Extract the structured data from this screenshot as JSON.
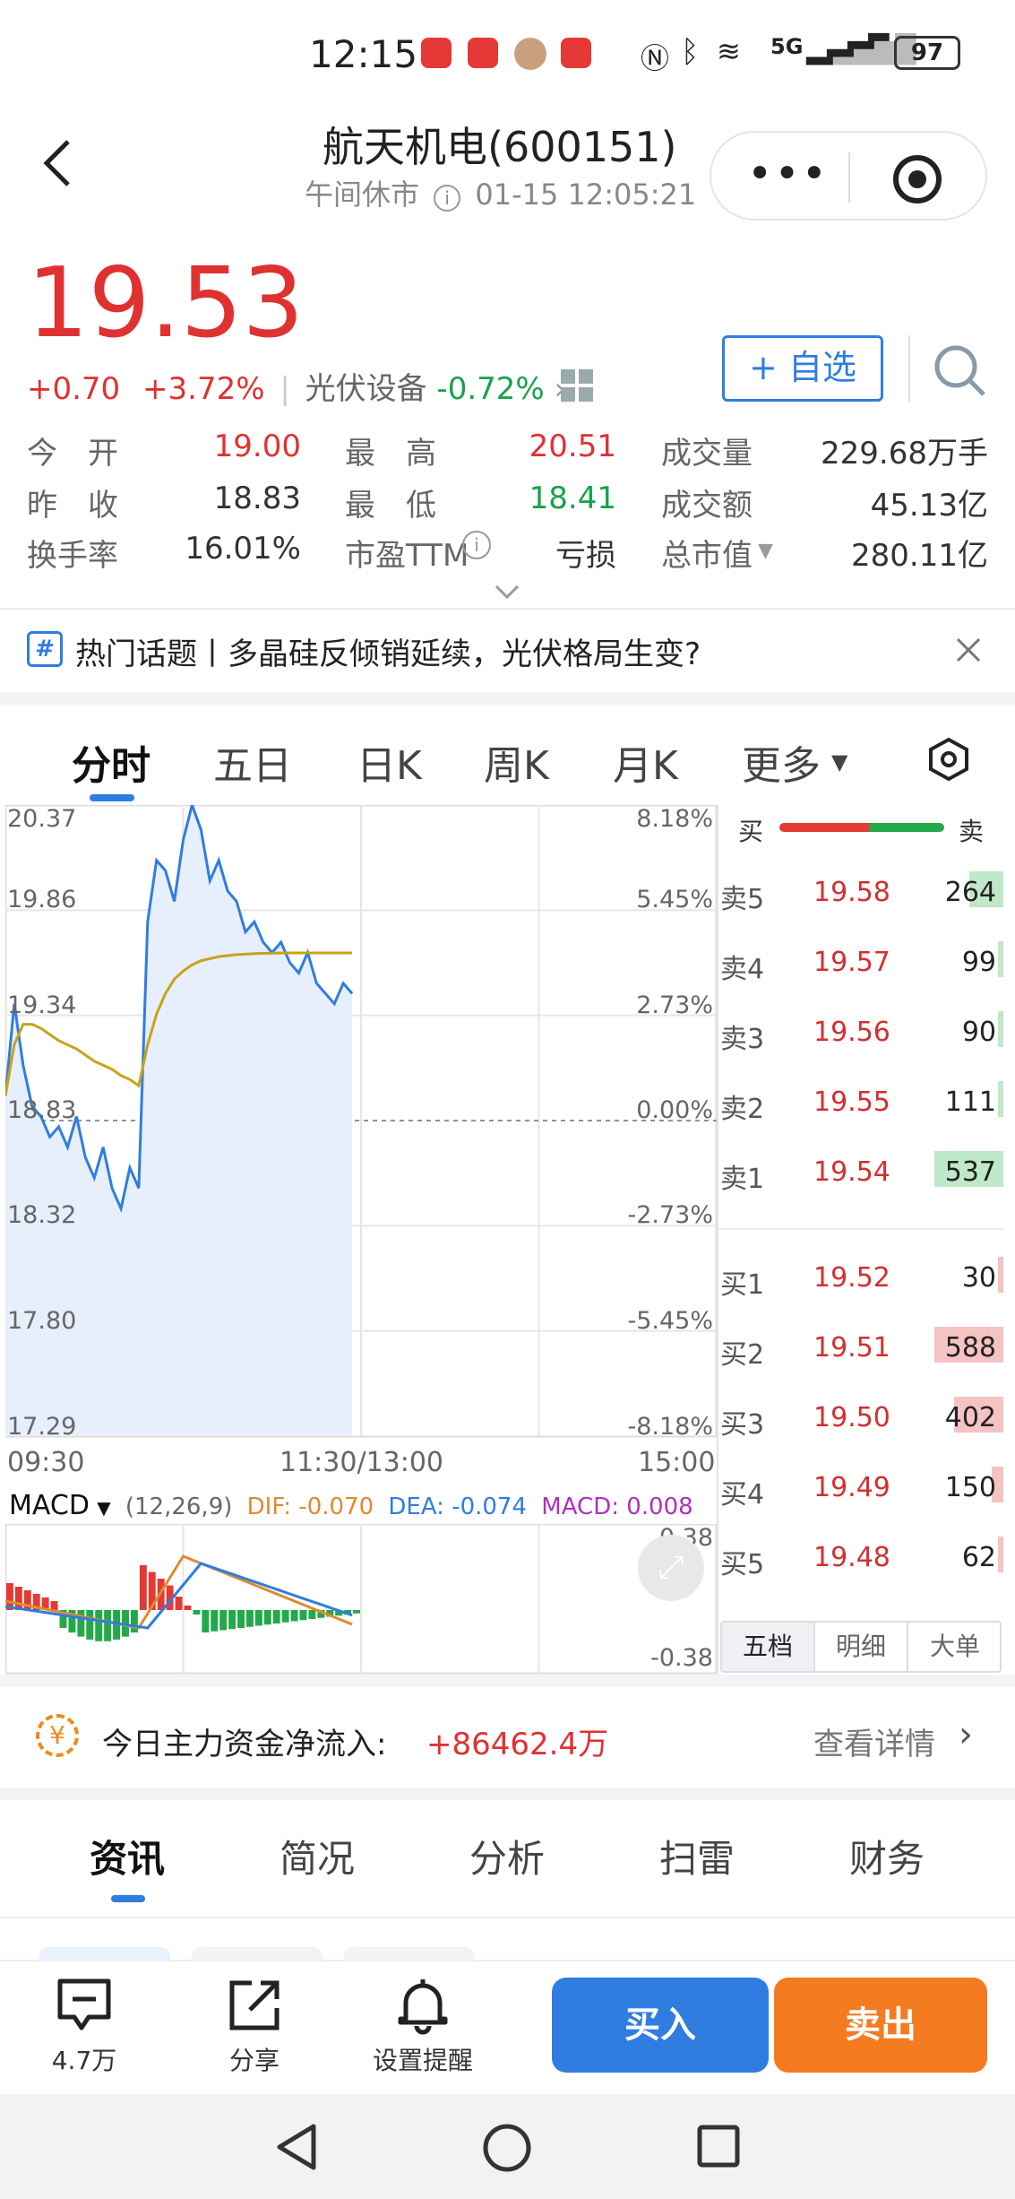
{
  "status_bar": {
    "time": "12:15",
    "battery": "97",
    "network": "5G"
  },
  "header": {
    "title": "航天机电(600151)",
    "market_status": "午间休市",
    "timestamp": "01-15 12:05:21"
  },
  "quote": {
    "price": "19.53",
    "change": "+0.70",
    "change_pct": "+3.72%",
    "sector_name": "光伏设备",
    "sector_change": "-0.72%",
    "watch_button": "+ 自选"
  },
  "stats": [
    {
      "label": "今　开",
      "value": "19.00",
      "tone": "red"
    },
    {
      "label": "最　高",
      "value": "20.51",
      "tone": "red"
    },
    {
      "label": "成交量",
      "value": "229.68万手",
      "tone": "plain"
    },
    {
      "label": "昨　收",
      "value": "18.83",
      "tone": "plain"
    },
    {
      "label": "最　低",
      "value": "18.41",
      "tone": "green"
    },
    {
      "label": "成交额",
      "value": "45.13亿",
      "tone": "plain"
    },
    {
      "label": "换手率",
      "value": "16.01%",
      "tone": "plain"
    },
    {
      "label": "市盈TTM",
      "value": "亏损",
      "tone": "plain"
    },
    {
      "label": "总市值",
      "value": "280.11亿",
      "tone": "plain"
    }
  ],
  "hot_topic": {
    "tag": "#",
    "text": "热门话题丨多晶硅反倾销延续，光伏格局生变?"
  },
  "chart_tabs": [
    "分时",
    "五日",
    "日K",
    "周K",
    "月K",
    "更多"
  ],
  "chart_data": {
    "type": "line",
    "title": "",
    "y_labels_left": [
      "20.37",
      "19.86",
      "19.34",
      "18.83",
      "18.32",
      "17.80",
      "17.29"
    ],
    "y_labels_right": [
      "8.18%",
      "5.45%",
      "2.73%",
      "0.00%",
      "-2.73%",
      "-5.45%",
      "-8.18%"
    ],
    "x_labels": [
      "09:30",
      "11:30/13:00",
      "15:00"
    ],
    "ylim": [
      17.29,
      20.37
    ],
    "prev_close": 18.83,
    "price_series": [
      18.95,
      19.4,
      19.1,
      18.9,
      18.85,
      18.75,
      18.8,
      18.7,
      18.85,
      18.65,
      18.55,
      18.7,
      18.5,
      18.4,
      18.6,
      18.5,
      19.8,
      20.1,
      20.05,
      19.9,
      20.2,
      20.37,
      20.25,
      20.0,
      20.1,
      19.95,
      19.9,
      19.75,
      19.8,
      19.7,
      19.65,
      19.7,
      19.6,
      19.55,
      19.65,
      19.5,
      19.45,
      19.4,
      19.5,
      19.45
    ],
    "avg_series": [
      18.95,
      19.2,
      19.3,
      19.3,
      19.28,
      19.25,
      19.22,
      19.2,
      19.18,
      19.15,
      19.12,
      19.1,
      19.08,
      19.05,
      19.03,
      19.0,
      19.2,
      19.35,
      19.45,
      19.52,
      19.56,
      19.59,
      19.61,
      19.62,
      19.63,
      19.635,
      19.64,
      19.642,
      19.645,
      19.646,
      19.647,
      19.648,
      19.648,
      19.648,
      19.648,
      19.648,
      19.648,
      19.648,
      19.648,
      19.648
    ],
    "macd": {
      "label": "MACD",
      "params": "(12,26,9)",
      "dif": "DIF: -0.070",
      "dea": "DEA: -0.074",
      "macd_val": "MACD: 0.008",
      "top": "0.38",
      "bottom": "-0.38"
    }
  },
  "orderbook": {
    "buy_label": "买",
    "sell_label": "卖",
    "asks": [
      {
        "label": "卖5",
        "price": "19.58",
        "vol": "264",
        "bar": 0.35
      },
      {
        "label": "卖4",
        "price": "19.57",
        "vol": "99",
        "bar": 0.05
      },
      {
        "label": "卖3",
        "price": "19.56",
        "vol": "90",
        "bar": 0.05
      },
      {
        "label": "卖2",
        "price": "19.55",
        "vol": "111",
        "bar": 0.05
      },
      {
        "label": "卖1",
        "price": "19.54",
        "vol": "537",
        "bar": 0.7
      }
    ],
    "bids": [
      {
        "label": "买1",
        "price": "19.52",
        "vol": "30",
        "bar": 0.02
      },
      {
        "label": "买2",
        "price": "19.51",
        "vol": "588",
        "bar": 0.7
      },
      {
        "label": "买3",
        "price": "19.50",
        "vol": "402",
        "bar": 0.5
      },
      {
        "label": "买4",
        "price": "19.49",
        "vol": "150",
        "bar": 0.12
      },
      {
        "label": "买5",
        "price": "19.48",
        "vol": "62",
        "bar": 0.04
      }
    ],
    "tabs": [
      "五档",
      "明细",
      "大单"
    ]
  },
  "capital_flow": {
    "label": "今日主力资金净流入:",
    "value": "+86462.4万",
    "link": "查看详情"
  },
  "news_tabs": [
    "资讯",
    "简况",
    "分析",
    "扫雷",
    "财务"
  ],
  "bottom_bar": {
    "comments": "4.7万",
    "share": "分享",
    "alert": "设置提醒",
    "buy": "买入",
    "sell": "卖出"
  }
}
